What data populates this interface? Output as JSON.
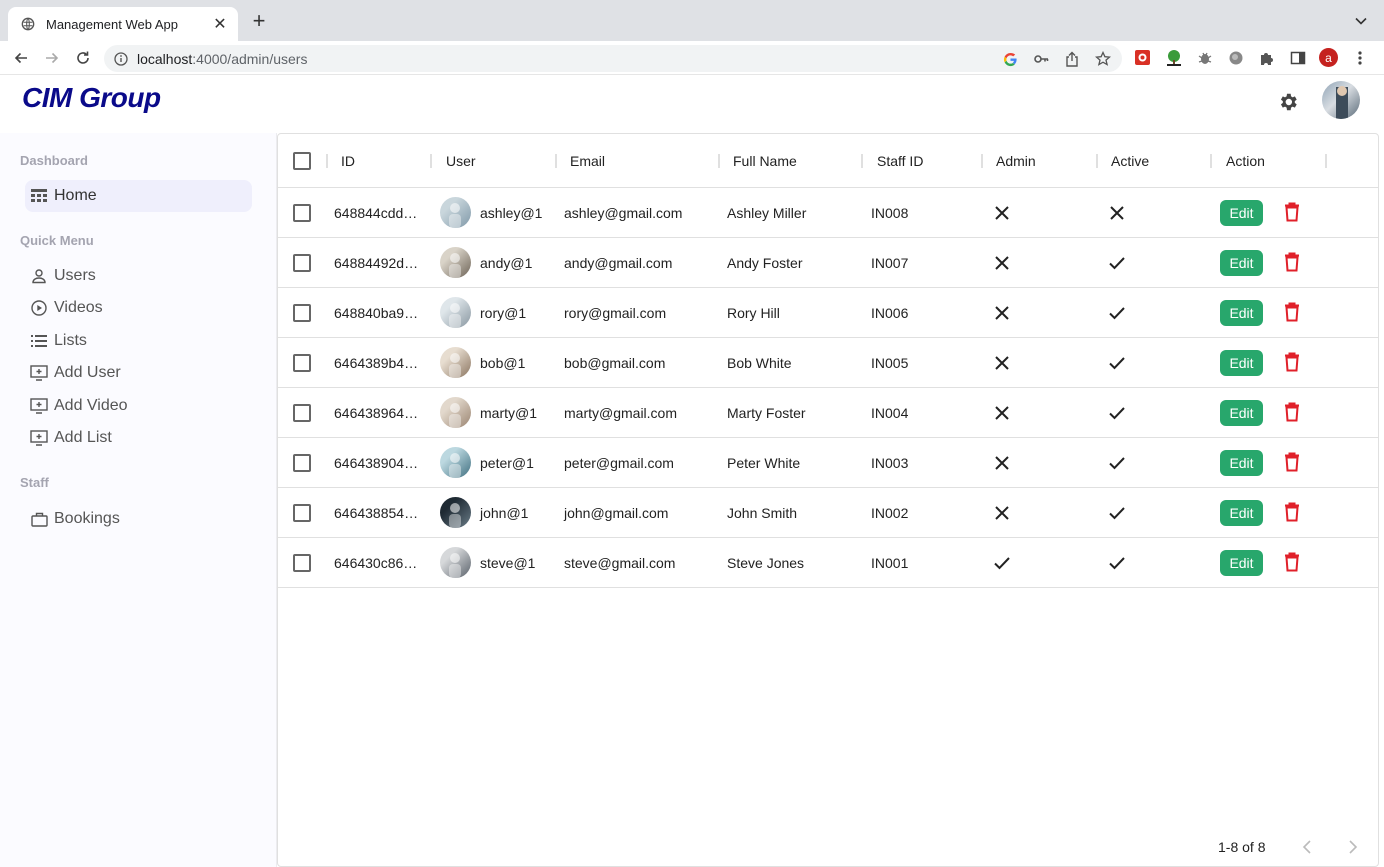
{
  "browser": {
    "tab_title": "Management Web App",
    "new_tab": "+",
    "url_host": "localhost",
    "url_rest": ":4000/admin/users",
    "profile_initial": "a"
  },
  "app": {
    "logo": "CIM Group"
  },
  "sidebar": {
    "sections": [
      {
        "title": "Dashboard",
        "items": [
          {
            "label": "Home",
            "icon": "dashboard-icon",
            "active": true
          }
        ]
      },
      {
        "title": "Quick Menu",
        "items": [
          {
            "label": "Users",
            "icon": "person-icon"
          },
          {
            "label": "Videos",
            "icon": "play-circle-icon"
          },
          {
            "label": "Lists",
            "icon": "list-icon"
          },
          {
            "label": "Add User",
            "icon": "add-to-queue-icon"
          },
          {
            "label": "Add Video",
            "icon": "add-to-queue-icon"
          },
          {
            "label": "Add List",
            "icon": "add-to-queue-icon"
          }
        ]
      },
      {
        "title": "Staff",
        "items": [
          {
            "label": "Bookings",
            "icon": "briefcase-icon"
          }
        ]
      }
    ]
  },
  "table": {
    "columns": [
      "ID",
      "User",
      "Email",
      "Full Name",
      "Staff ID",
      "Admin",
      "Active",
      "Action"
    ],
    "edit_label": "Edit",
    "rows": [
      {
        "id": "648844cdd…",
        "user": "ashley@1",
        "email": "ashley@gmail.com",
        "full_name": "Ashley Miller",
        "staff_id": "IN008",
        "admin": false,
        "active": false
      },
      {
        "id": "64884492d…",
        "user": "andy@1",
        "email": "andy@gmail.com",
        "full_name": "Andy Foster",
        "staff_id": "IN007",
        "admin": false,
        "active": true
      },
      {
        "id": "648840ba9…",
        "user": "rory@1",
        "email": "rory@gmail.com",
        "full_name": "Rory Hill",
        "staff_id": "IN006",
        "admin": false,
        "active": true
      },
      {
        "id": "6464389b4…",
        "user": "bob@1",
        "email": "bob@gmail.com",
        "full_name": "Bob White",
        "staff_id": "IN005",
        "admin": false,
        "active": true
      },
      {
        "id": "646438964…",
        "user": "marty@1",
        "email": "marty@gmail.com",
        "full_name": "Marty Foster",
        "staff_id": "IN004",
        "admin": false,
        "active": true
      },
      {
        "id": "646438904…",
        "user": "peter@1",
        "email": "peter@gmail.com",
        "full_name": "Peter White",
        "staff_id": "IN003",
        "admin": false,
        "active": true
      },
      {
        "id": "646438854…",
        "user": "john@1",
        "email": "john@gmail.com",
        "full_name": "John Smith",
        "staff_id": "IN002",
        "admin": false,
        "active": true
      },
      {
        "id": "646430c86…",
        "user": "steve@1",
        "email": "steve@gmail.com",
        "full_name": "Steve Jones",
        "staff_id": "IN001",
        "admin": true,
        "active": true
      }
    ],
    "pagination": "1-8 of 8"
  },
  "colors": {
    "edit_green": "#28a76c",
    "delete_red": "#e0202a",
    "logo_blue": "#0a0a8a"
  }
}
